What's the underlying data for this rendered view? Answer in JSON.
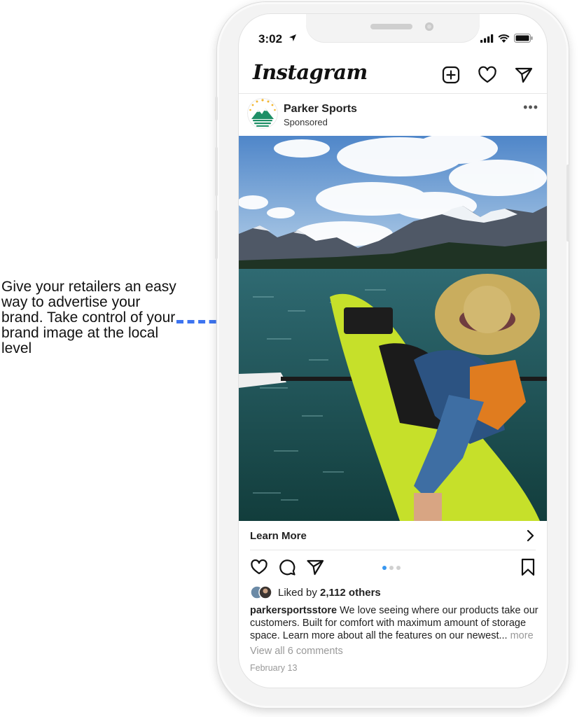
{
  "callout": {
    "text": "Give your retailers an easy way to advertise your brand. Take control of your brand image at the local level",
    "accent_color": "#3d74f0"
  },
  "status_bar": {
    "time": "3:02",
    "icons": [
      "location-arrow-icon",
      "signal-icon",
      "wifi-icon",
      "battery-icon"
    ]
  },
  "app": {
    "name": "Instagram",
    "header_icons": [
      "new-post-icon",
      "heart-icon",
      "direct-message-icon"
    ]
  },
  "post": {
    "account_name": "Parker Sports",
    "label": "Sponsored",
    "more_icon": "•••",
    "cta_label": "Learn More",
    "action_icons": [
      "like-icon",
      "comment-icon",
      "share-icon",
      "bookmark-icon"
    ],
    "carousel": {
      "total": 3,
      "active": 1,
      "active_color": "#3897f0"
    },
    "likes_prefix": "Liked by",
    "likes_count": "2,112 others",
    "caption_handle": "parkersportsstore",
    "caption_text": " We love seeing where our products take our customers. Built for comfort with maximum amount of storage space. Learn more about all the features on our newest...",
    "caption_more": " more",
    "comments_link": "View all 6 comments",
    "date": "February 13"
  }
}
